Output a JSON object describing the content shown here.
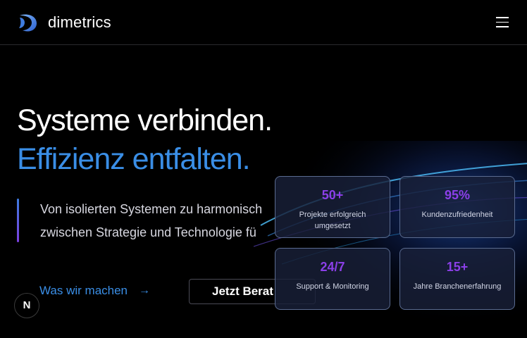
{
  "header": {
    "brand": "dimetrics",
    "logo_icon": "dimetrics-logo-icon",
    "menu_icon": "hamburger-menu-icon"
  },
  "hero": {
    "title_line1": "Systeme verbinden.",
    "title_line2": "Effizienz entfalten.",
    "lead_line1": "Von isolierten Systemen zu harmonisch",
    "lead_line2": "zwischen Strategie und Technologie fü",
    "link_label": "Was wir machen",
    "link_arrow": "→",
    "cta_label": "Jetzt Berat"
  },
  "stats": [
    {
      "value": "50+",
      "label": "Projekte erfolgreich umgesetzt"
    },
    {
      "value": "95%",
      "label": "Kundenzufriedenheit"
    },
    {
      "value": "24/7",
      "label": "Support & Monitoring"
    },
    {
      "value": "15+",
      "label": "Jahre Branchenerfahrung"
    }
  ],
  "badge": {
    "label": "N"
  },
  "colors": {
    "accent_blue": "#3a8ee6",
    "stat_purple": "#8b3fe8",
    "background": "#000000"
  }
}
